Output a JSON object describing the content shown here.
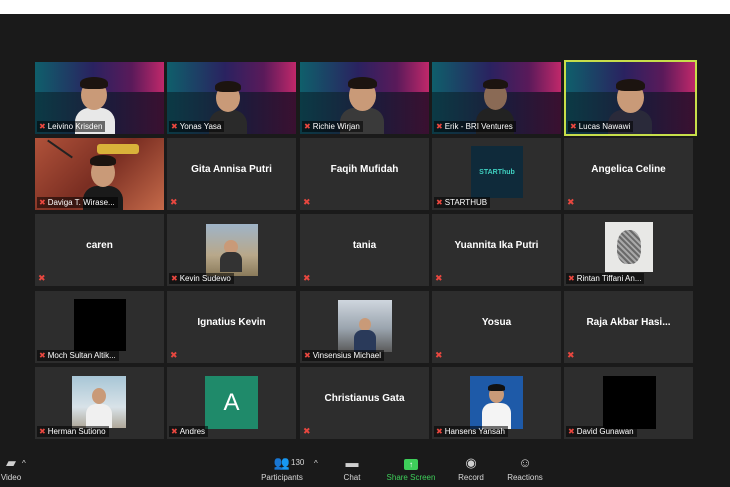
{
  "colors": {
    "active_border": "#c7de4a",
    "muted_icon": "#e8473f",
    "share_green": "#3ecf5a",
    "tile_bg": "#2d2d2d"
  },
  "participants": {
    "p1": "Leivino Krisden",
    "p2": "Yonas Yasa",
    "p3": "Richie Wirjan",
    "p4": "Erik - BRI Ventures",
    "p5": "Lucas Nawawi",
    "p6": "Daviga T. Wirase...",
    "p7": "Gita Annisa Putri",
    "p8": "Faqih Mufidah",
    "p9": "STARTHUB",
    "p10": "Angelica Celine",
    "p11": "caren",
    "p12": "Kevin Sudewo",
    "p13": "tania",
    "p14": "Yuannita Ika Putri",
    "p15": "Rintan Tiffani An...",
    "p16": "Moch Sultan Altik...",
    "p17": "Ignatius Kevin",
    "p18": "Vinsensius Michael",
    "p19": "Yosua",
    "p20": "Raja Akbar Hasi...",
    "p21": "Herman Sutiono",
    "p22": "Andres",
    "p23": "Christianus Gata",
    "p24": "Hansens Yansah",
    "p25": "David Gunawan"
  },
  "avatar_letter": "A",
  "starthub_logo_text": "STARThub",
  "toolbar": {
    "video": "Video",
    "participants": "Participants",
    "participants_count": "130",
    "chat": "Chat",
    "share_screen": "Share Screen",
    "record": "Record",
    "reactions": "Reactions"
  },
  "icons": {
    "mic_muted": "muted-mic-icon",
    "video": "video-camera-icon",
    "participants": "participants-icon",
    "chat": "chat-bubble-icon",
    "share": "share-screen-icon",
    "record": "record-icon",
    "reactions": "reactions-icon"
  }
}
